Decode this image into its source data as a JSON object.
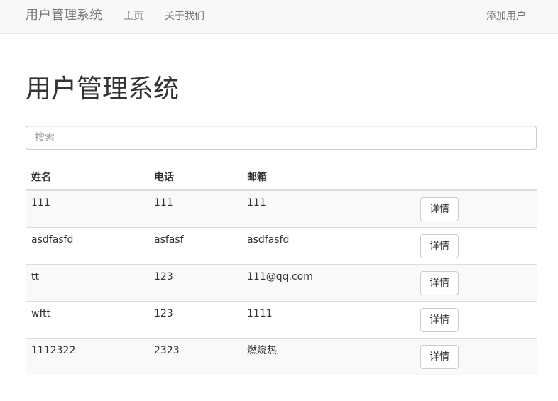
{
  "navbar": {
    "brand": "用户管理系统",
    "home": "主页",
    "about": "关于我们",
    "add_user": "添加用户"
  },
  "page": {
    "title": "用户管理系统"
  },
  "search": {
    "placeholder": "搜索",
    "value": ""
  },
  "table": {
    "headers": [
      "姓名",
      "电话",
      "邮箱",
      ""
    ],
    "rows": [
      {
        "name": "111",
        "phone": "111",
        "email": "111",
        "action": "详情"
      },
      {
        "name": "asdfasfd",
        "phone": "asfasf",
        "email": "asdfasfd",
        "action": "详情"
      },
      {
        "name": "tt",
        "phone": "123",
        "email": "111@qq.com",
        "action": "详情"
      },
      {
        "name": "wftt",
        "phone": "123",
        "email": "1111",
        "action": "详情"
      },
      {
        "name": "1112322",
        "phone": "2323",
        "email": "燃烧热",
        "action": "详情"
      }
    ]
  },
  "colors": {
    "navbar_bg": "#f8f8f8",
    "striped_row_bg": "#f9f9f9",
    "border": "#dddddd"
  }
}
